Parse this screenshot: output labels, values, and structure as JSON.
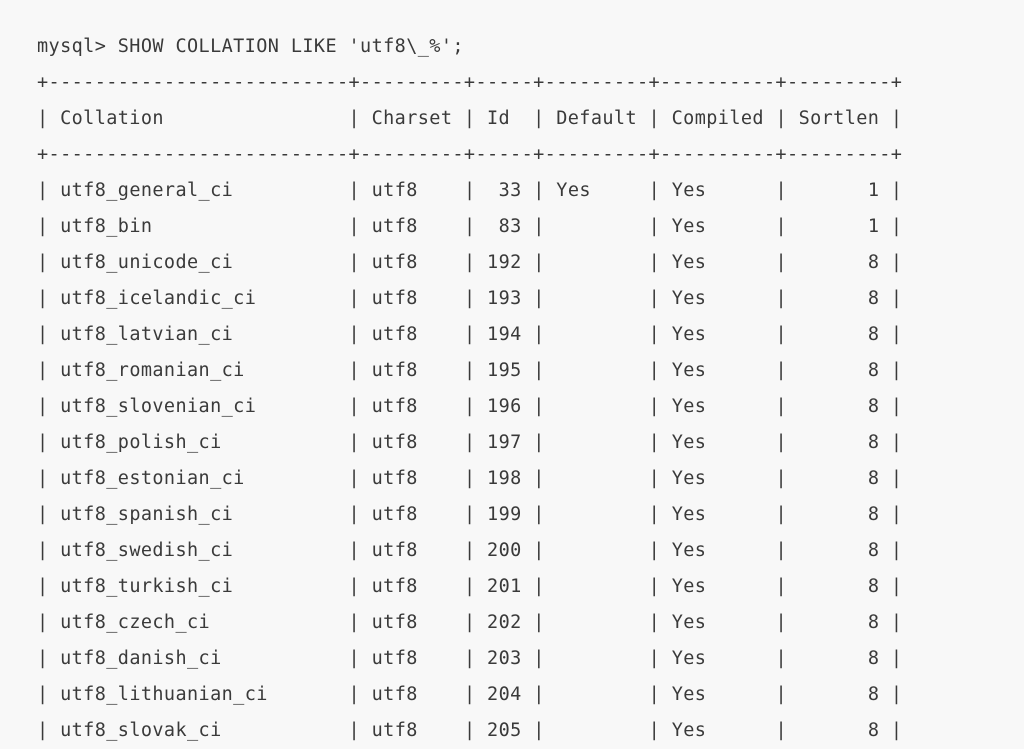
{
  "terminal": {
    "prompt": "mysql> ",
    "command": "SHOW COLLATION LIKE 'utf8\\_%';",
    "separator": "+--------------------------+---------+-----+---------+----------+---------+",
    "columns": [
      "Collation",
      "Charset",
      "Id",
      "Default",
      "Compiled",
      "Sortlen"
    ],
    "rows": [
      {
        "collation": "utf8_general_ci",
        "charset": "utf8",
        "id": "33",
        "default": "Yes",
        "compiled": "Yes",
        "sortlen": "1"
      },
      {
        "collation": "utf8_bin",
        "charset": "utf8",
        "id": "83",
        "default": "",
        "compiled": "Yes",
        "sortlen": "1"
      },
      {
        "collation": "utf8_unicode_ci",
        "charset": "utf8",
        "id": "192",
        "default": "",
        "compiled": "Yes",
        "sortlen": "8"
      },
      {
        "collation": "utf8_icelandic_ci",
        "charset": "utf8",
        "id": "193",
        "default": "",
        "compiled": "Yes",
        "sortlen": "8"
      },
      {
        "collation": "utf8_latvian_ci",
        "charset": "utf8",
        "id": "194",
        "default": "",
        "compiled": "Yes",
        "sortlen": "8"
      },
      {
        "collation": "utf8_romanian_ci",
        "charset": "utf8",
        "id": "195",
        "default": "",
        "compiled": "Yes",
        "sortlen": "8"
      },
      {
        "collation": "utf8_slovenian_ci",
        "charset": "utf8",
        "id": "196",
        "default": "",
        "compiled": "Yes",
        "sortlen": "8"
      },
      {
        "collation": "utf8_polish_ci",
        "charset": "utf8",
        "id": "197",
        "default": "",
        "compiled": "Yes",
        "sortlen": "8"
      },
      {
        "collation": "utf8_estonian_ci",
        "charset": "utf8",
        "id": "198",
        "default": "",
        "compiled": "Yes",
        "sortlen": "8"
      },
      {
        "collation": "utf8_spanish_ci",
        "charset": "utf8",
        "id": "199",
        "default": "",
        "compiled": "Yes",
        "sortlen": "8"
      },
      {
        "collation": "utf8_swedish_ci",
        "charset": "utf8",
        "id": "200",
        "default": "",
        "compiled": "Yes",
        "sortlen": "8"
      },
      {
        "collation": "utf8_turkish_ci",
        "charset": "utf8",
        "id": "201",
        "default": "",
        "compiled": "Yes",
        "sortlen": "8"
      },
      {
        "collation": "utf8_czech_ci",
        "charset": "utf8",
        "id": "202",
        "default": "",
        "compiled": "Yes",
        "sortlen": "8"
      },
      {
        "collation": "utf8_danish_ci",
        "charset": "utf8",
        "id": "203",
        "default": "",
        "compiled": "Yes",
        "sortlen": "8"
      },
      {
        "collation": "utf8_lithuanian_ci",
        "charset": "utf8",
        "id": "204",
        "default": "",
        "compiled": "Yes",
        "sortlen": "8"
      },
      {
        "collation": "utf8_slovak_ci",
        "charset": "utf8",
        "id": "205",
        "default": "",
        "compiled": "Yes",
        "sortlen": "8"
      }
    ]
  }
}
